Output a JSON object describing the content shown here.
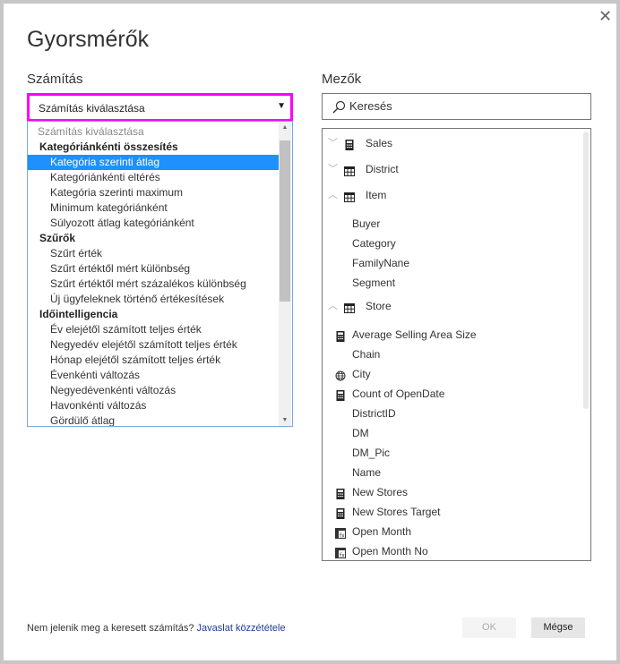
{
  "dialog": {
    "title": "Gyorsmérők",
    "close_label": "✕"
  },
  "calculation": {
    "label": "Számítás",
    "selected": "Számítás kiválasztása",
    "options": [
      {
        "text": "Számítás kiválasztása",
        "kind": "placeholder"
      },
      {
        "text": "Kategóriánkénti összesítés",
        "kind": "group"
      },
      {
        "text": "Kategória szerinti átlag",
        "kind": "item",
        "highlighted": true
      },
      {
        "text": "Kategóriánkénti eltérés",
        "kind": "item"
      },
      {
        "text": "Kategória szerinti maximum",
        "kind": "item"
      },
      {
        "text": "Minimum kategóriánként",
        "kind": "item"
      },
      {
        "text": "Súlyozott átlag kategóriánként",
        "kind": "item"
      },
      {
        "text": "Szűrők",
        "kind": "group"
      },
      {
        "text": "Szűrt érték",
        "kind": "item"
      },
      {
        "text": "Szűrt értéktől mért különbség",
        "kind": "item"
      },
      {
        "text": "Szűrt értéktől mért százalékos különbség",
        "kind": "item"
      },
      {
        "text": "Új ügyfeleknek történő értékesítések",
        "kind": "item"
      },
      {
        "text": "Időintelligencia",
        "kind": "group"
      },
      {
        "text": "Év elejétől számított teljes érték",
        "kind": "item"
      },
      {
        "text": "Negyedév elejétől számított teljes érték",
        "kind": "item"
      },
      {
        "text": "Hónap elejétől számított teljes érték",
        "kind": "item"
      },
      {
        "text": "Évenkénti változás",
        "kind": "item"
      },
      {
        "text": "Negyedévenkénti változás",
        "kind": "item"
      },
      {
        "text": "Havonkénti változás",
        "kind": "item"
      },
      {
        "text": "Gördülő átlag",
        "kind": "item"
      }
    ]
  },
  "fields": {
    "label": "Mezők",
    "search_placeholder": "Keresés",
    "tables": [
      {
        "name": "Sales",
        "icon": "calculator-icon",
        "expanded": false,
        "children": []
      },
      {
        "name": "District",
        "icon": "table-icon",
        "expanded": false,
        "children": []
      },
      {
        "name": "Item",
        "icon": "table-icon",
        "expanded": true,
        "children": [
          {
            "name": "Buyer",
            "icon": ""
          },
          {
            "name": "Category",
            "icon": ""
          },
          {
            "name": "FamilyNane",
            "icon": ""
          },
          {
            "name": "Segment",
            "icon": ""
          }
        ]
      },
      {
        "name": "Store",
        "icon": "table-icon",
        "expanded": true,
        "children": [
          {
            "name": "Average Selling Area Size",
            "icon": "calculator-icon"
          },
          {
            "name": "Chain",
            "icon": ""
          },
          {
            "name": "City",
            "icon": "globe-icon"
          },
          {
            "name": "Count of OpenDate",
            "icon": "calculator-icon"
          },
          {
            "name": "DistrictID",
            "icon": ""
          },
          {
            "name": "DM",
            "icon": ""
          },
          {
            "name": "DM_Pic",
            "icon": ""
          },
          {
            "name": "Name",
            "icon": ""
          },
          {
            "name": "New Stores",
            "icon": "calculator-icon"
          },
          {
            "name": "New Stores Target",
            "icon": "calculator-icon"
          },
          {
            "name": "Open Month",
            "icon": "calculated-column-icon"
          },
          {
            "name": "Open Month No",
            "icon": "calculated-column-icon"
          }
        ]
      }
    ]
  },
  "footer": {
    "text": "Nem jelenik meg a keresett számítás?",
    "link": "Javaslat közzététele",
    "ok": "OK",
    "cancel": "Mégse"
  },
  "colors": {
    "highlight": "#1e90ff",
    "focus_border": "#ff00ff",
    "link": "#1f3c99"
  }
}
